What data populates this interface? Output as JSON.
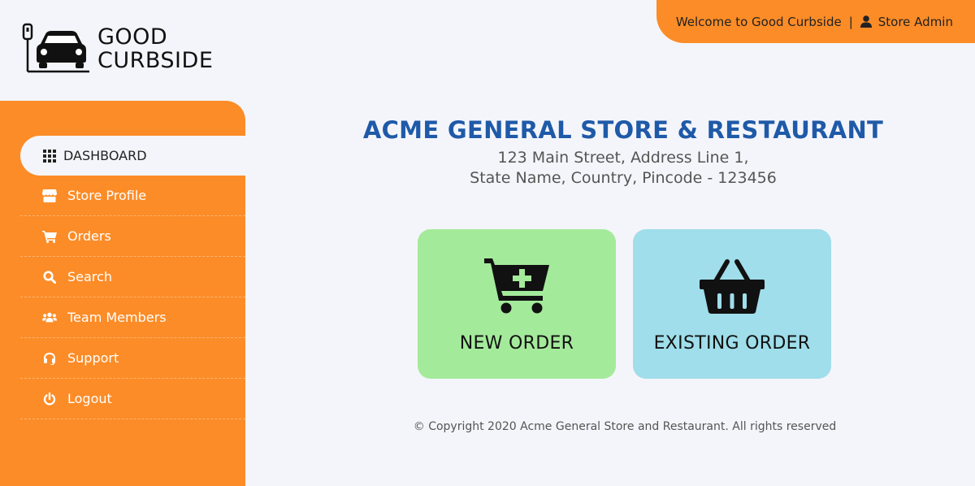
{
  "brand": {
    "line1": "GOOD",
    "line2": "CURBSIDE",
    "accent_color": "#fc8c27"
  },
  "topbar": {
    "welcome": "Welcome to Good Curbside",
    "separator": "|",
    "user": "Store Admin",
    "user_icon": "user-icon"
  },
  "sidebar": {
    "items": [
      {
        "label": "DASHBOARD",
        "icon": "grid-icon",
        "active": true
      },
      {
        "label": "Store Profile",
        "icon": "store-icon"
      },
      {
        "label": "Orders",
        "icon": "cart-icon"
      },
      {
        "label": "Search",
        "icon": "search-icon"
      },
      {
        "label": "Team Members",
        "icon": "team-icon"
      },
      {
        "label": "Support",
        "icon": "headset-icon"
      },
      {
        "label": "Logout",
        "icon": "power-icon"
      }
    ]
  },
  "main": {
    "store_name": "ACME GENERAL STORE & RESTAURANT",
    "address_line1": "123 Main Street, Address Line 1,",
    "address_line2": "State Name, Country, Pincode - 123456",
    "cards": {
      "new_order": {
        "label": "NEW ORDER",
        "color": "#a4ea9b",
        "icon": "cart-plus-icon"
      },
      "existing_order": {
        "label": "EXISTING ORDER",
        "color": "#9fdeea",
        "icon": "basket-icon"
      }
    },
    "copyright": "© Copyright 2020 Acme General Store and Restaurant. All rights reserved"
  }
}
